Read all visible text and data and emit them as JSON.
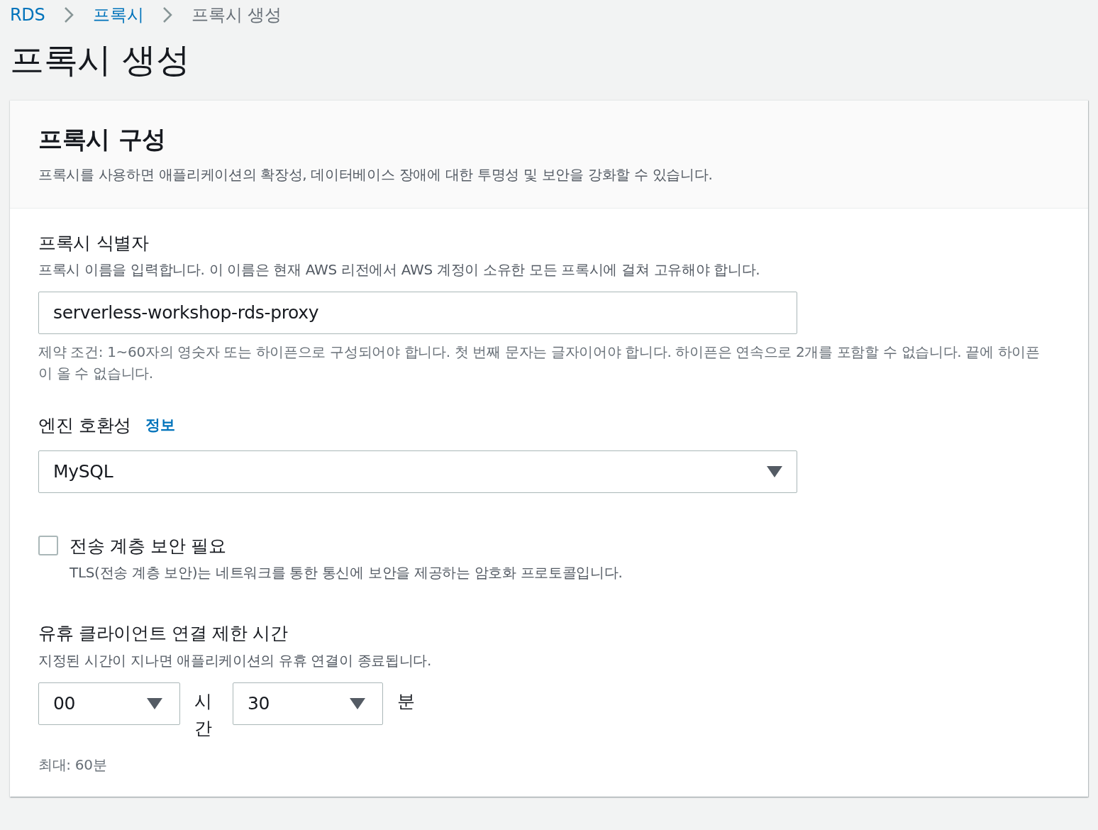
{
  "breadcrumb": [
    {
      "label": "RDS",
      "link": true
    },
    {
      "label": "프록시",
      "link": true
    },
    {
      "label": "프록시 생성",
      "link": false
    }
  ],
  "page_title": "프록시 생성",
  "section": {
    "title": "프록시 구성",
    "description": "프록시를 사용하면 애플리케이션의 확장성, 데이터베이스 장애에 대한 투명성 및 보안을 강화할 수 있습니다."
  },
  "fields": [
    {
      "kind": "text",
      "label": "프록시 식별자",
      "description": "프록시 이름을 입력합니다. 이 이름은 현재 AWS 리전에서 AWS 계정이 소유한 모든 프록시에 걸쳐 고유해야 합니다.",
      "value": "serverless-workshop-rds-proxy",
      "constraint": "제약 조건: 1~60자의 영숫자 또는 하이픈으로 구성되어야 합니다. 첫 번째 문자는 글자이어야 합니다. 하이픈은 연속으로 2개를 포함할 수 없습니다. 끝에 하이픈이 올 수 없습니다."
    },
    {
      "kind": "select",
      "label": "엔진 호환성",
      "info": "정보",
      "value": "MySQL"
    },
    {
      "kind": "checkbox",
      "label": "전송 계층 보안 필요",
      "description": "TLS(전송 계층 보안)는 네트워크를 통한 통신에 보안을 제공하는 암호화 프로토콜입니다.",
      "checked": false
    },
    {
      "kind": "duration",
      "label": "유휴 클라이언트 연결 제한 시간",
      "description": "지정된 시간이 지나면 애플리케이션의 유휴 연결이 종료됩니다.",
      "parts": [
        {
          "value": "00",
          "unit": "시간"
        },
        {
          "value": "30",
          "unit": "분"
        }
      ],
      "constraint": "최대: 60분"
    }
  ]
}
